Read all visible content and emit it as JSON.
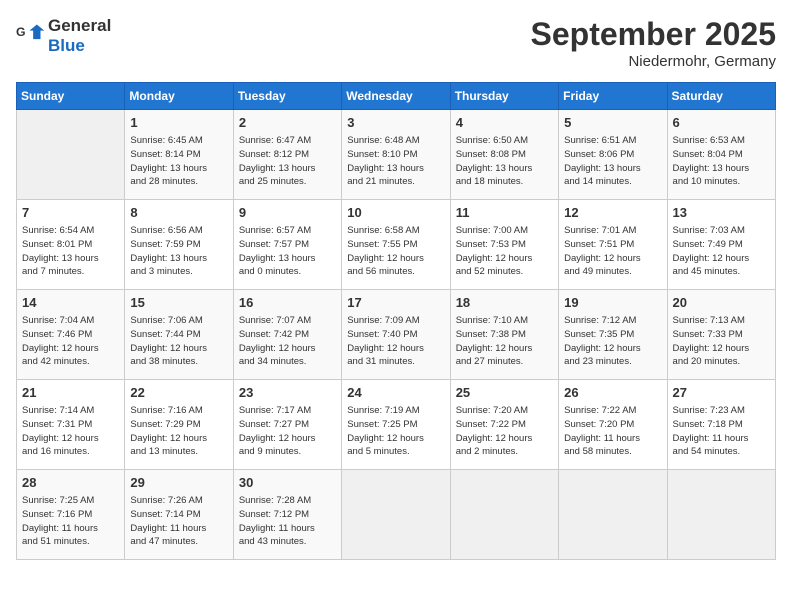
{
  "logo": {
    "text_general": "General",
    "text_blue": "Blue"
  },
  "header": {
    "month": "September 2025",
    "location": "Niedermohr, Germany"
  },
  "weekdays": [
    "Sunday",
    "Monday",
    "Tuesday",
    "Wednesday",
    "Thursday",
    "Friday",
    "Saturday"
  ],
  "weeks": [
    [
      {
        "day": "",
        "info": ""
      },
      {
        "day": "1",
        "info": "Sunrise: 6:45 AM\nSunset: 8:14 PM\nDaylight: 13 hours\nand 28 minutes."
      },
      {
        "day": "2",
        "info": "Sunrise: 6:47 AM\nSunset: 8:12 PM\nDaylight: 13 hours\nand 25 minutes."
      },
      {
        "day": "3",
        "info": "Sunrise: 6:48 AM\nSunset: 8:10 PM\nDaylight: 13 hours\nand 21 minutes."
      },
      {
        "day": "4",
        "info": "Sunrise: 6:50 AM\nSunset: 8:08 PM\nDaylight: 13 hours\nand 18 minutes."
      },
      {
        "day": "5",
        "info": "Sunrise: 6:51 AM\nSunset: 8:06 PM\nDaylight: 13 hours\nand 14 minutes."
      },
      {
        "day": "6",
        "info": "Sunrise: 6:53 AM\nSunset: 8:04 PM\nDaylight: 13 hours\nand 10 minutes."
      }
    ],
    [
      {
        "day": "7",
        "info": "Sunrise: 6:54 AM\nSunset: 8:01 PM\nDaylight: 13 hours\nand 7 minutes."
      },
      {
        "day": "8",
        "info": "Sunrise: 6:56 AM\nSunset: 7:59 PM\nDaylight: 13 hours\nand 3 minutes."
      },
      {
        "day": "9",
        "info": "Sunrise: 6:57 AM\nSunset: 7:57 PM\nDaylight: 13 hours\nand 0 minutes."
      },
      {
        "day": "10",
        "info": "Sunrise: 6:58 AM\nSunset: 7:55 PM\nDaylight: 12 hours\nand 56 minutes."
      },
      {
        "day": "11",
        "info": "Sunrise: 7:00 AM\nSunset: 7:53 PM\nDaylight: 12 hours\nand 52 minutes."
      },
      {
        "day": "12",
        "info": "Sunrise: 7:01 AM\nSunset: 7:51 PM\nDaylight: 12 hours\nand 49 minutes."
      },
      {
        "day": "13",
        "info": "Sunrise: 7:03 AM\nSunset: 7:49 PM\nDaylight: 12 hours\nand 45 minutes."
      }
    ],
    [
      {
        "day": "14",
        "info": "Sunrise: 7:04 AM\nSunset: 7:46 PM\nDaylight: 12 hours\nand 42 minutes."
      },
      {
        "day": "15",
        "info": "Sunrise: 7:06 AM\nSunset: 7:44 PM\nDaylight: 12 hours\nand 38 minutes."
      },
      {
        "day": "16",
        "info": "Sunrise: 7:07 AM\nSunset: 7:42 PM\nDaylight: 12 hours\nand 34 minutes."
      },
      {
        "day": "17",
        "info": "Sunrise: 7:09 AM\nSunset: 7:40 PM\nDaylight: 12 hours\nand 31 minutes."
      },
      {
        "day": "18",
        "info": "Sunrise: 7:10 AM\nSunset: 7:38 PM\nDaylight: 12 hours\nand 27 minutes."
      },
      {
        "day": "19",
        "info": "Sunrise: 7:12 AM\nSunset: 7:35 PM\nDaylight: 12 hours\nand 23 minutes."
      },
      {
        "day": "20",
        "info": "Sunrise: 7:13 AM\nSunset: 7:33 PM\nDaylight: 12 hours\nand 20 minutes."
      }
    ],
    [
      {
        "day": "21",
        "info": "Sunrise: 7:14 AM\nSunset: 7:31 PM\nDaylight: 12 hours\nand 16 minutes."
      },
      {
        "day": "22",
        "info": "Sunrise: 7:16 AM\nSunset: 7:29 PM\nDaylight: 12 hours\nand 13 minutes."
      },
      {
        "day": "23",
        "info": "Sunrise: 7:17 AM\nSunset: 7:27 PM\nDaylight: 12 hours\nand 9 minutes."
      },
      {
        "day": "24",
        "info": "Sunrise: 7:19 AM\nSunset: 7:25 PM\nDaylight: 12 hours\nand 5 minutes."
      },
      {
        "day": "25",
        "info": "Sunrise: 7:20 AM\nSunset: 7:22 PM\nDaylight: 12 hours\nand 2 minutes."
      },
      {
        "day": "26",
        "info": "Sunrise: 7:22 AM\nSunset: 7:20 PM\nDaylight: 11 hours\nand 58 minutes."
      },
      {
        "day": "27",
        "info": "Sunrise: 7:23 AM\nSunset: 7:18 PM\nDaylight: 11 hours\nand 54 minutes."
      }
    ],
    [
      {
        "day": "28",
        "info": "Sunrise: 7:25 AM\nSunset: 7:16 PM\nDaylight: 11 hours\nand 51 minutes."
      },
      {
        "day": "29",
        "info": "Sunrise: 7:26 AM\nSunset: 7:14 PM\nDaylight: 11 hours\nand 47 minutes."
      },
      {
        "day": "30",
        "info": "Sunrise: 7:28 AM\nSunset: 7:12 PM\nDaylight: 11 hours\nand 43 minutes."
      },
      {
        "day": "",
        "info": ""
      },
      {
        "day": "",
        "info": ""
      },
      {
        "day": "",
        "info": ""
      },
      {
        "day": "",
        "info": ""
      }
    ]
  ]
}
